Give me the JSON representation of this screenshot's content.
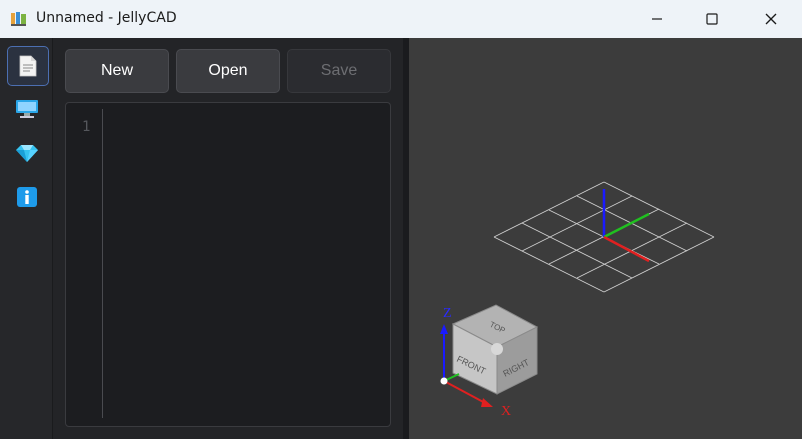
{
  "window": {
    "title": "Unnamed - JellyCAD",
    "controls": [
      "minimize-icon",
      "maximize-icon",
      "close-icon"
    ]
  },
  "activity_bar": {
    "items": [
      {
        "icon": "document-icon",
        "active": true
      },
      {
        "icon": "monitor-icon",
        "active": false
      },
      {
        "icon": "diamond-icon",
        "active": false
      },
      {
        "icon": "info-icon",
        "active": false
      }
    ]
  },
  "toolbar": {
    "new_label": "New",
    "open_label": "Open",
    "save_label": "Save",
    "save_enabled": false
  },
  "editor": {
    "line_numbers": [
      "1"
    ],
    "content": ""
  },
  "viewcube": {
    "top": "TOP",
    "front": "FRONT",
    "right": "RIGHT"
  },
  "axes": {
    "x_label": "X",
    "z_label": "Z",
    "x_color": "#e02020",
    "y_color": "#20c020",
    "z_color": "#1a1aff"
  },
  "colors": {
    "accent": "#4c6fb2",
    "viewport_bg": "#3c3c3c"
  }
}
